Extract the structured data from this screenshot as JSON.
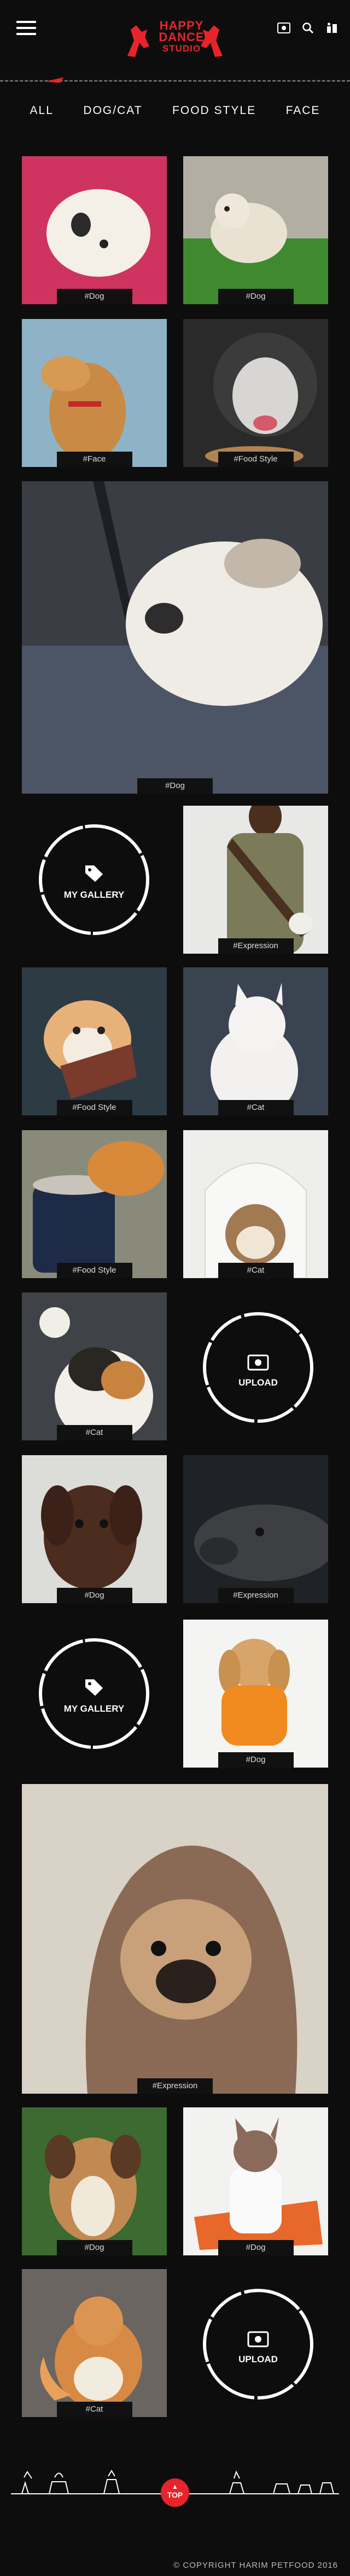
{
  "header": {
    "logo_lines": [
      "HAPPY",
      "DANCE",
      "STUDIO"
    ],
    "icons": [
      "photo-icon",
      "search-icon",
      "user-profile-icon"
    ]
  },
  "nav": [
    "ALL",
    "DOG/CAT",
    "FOOD STYLE",
    "FACE"
  ],
  "tiles": [
    {
      "tag": "#Dog"
    },
    {
      "tag": "#Dog"
    },
    {
      "tag": "#Face"
    },
    {
      "tag": "#Food Style"
    },
    {
      "tag": "#Dog"
    },
    {
      "tag": "#Expression"
    },
    {
      "tag": "#Food Style"
    },
    {
      "tag": "#Cat"
    },
    {
      "tag": "#Food Style"
    },
    {
      "tag": "#Cat"
    },
    {
      "tag": "#Cat"
    },
    {
      "tag": "#Dog"
    },
    {
      "tag": "#Expression"
    },
    {
      "tag": "#Dog"
    },
    {
      "tag": "#Expression"
    },
    {
      "tag": "#Dog"
    },
    {
      "tag": "#Dog"
    },
    {
      "tag": "#Cat"
    }
  ],
  "buttons": {
    "gallery": "MY GALLERY",
    "upload": "UPLOAD"
  },
  "footer": {
    "top": "TOP",
    "copyright": "© COPYRIGHT HARIM PETFOOD 2016"
  },
  "colors": {
    "accent": "#e8242b",
    "background": "#0d0d0d"
  }
}
